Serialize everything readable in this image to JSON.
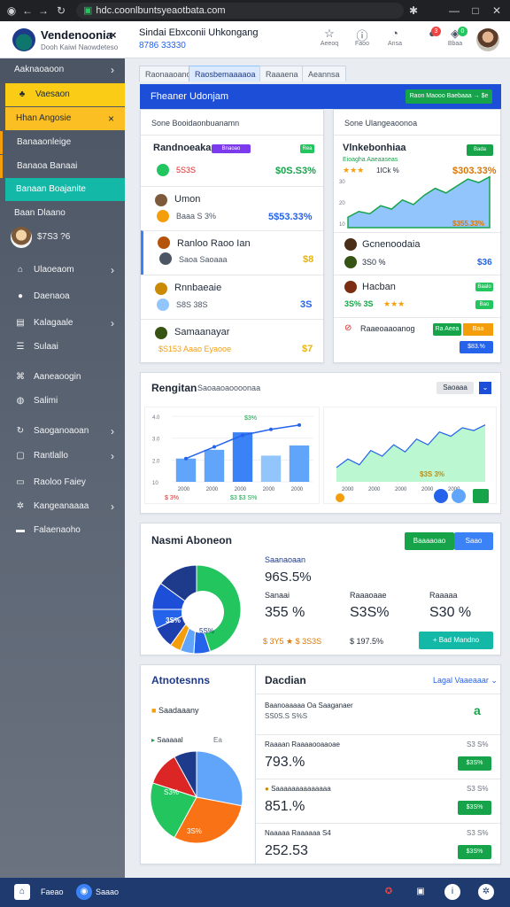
{
  "browser": {
    "url": "hdc.coonlbuntsyeaotbata.com"
  },
  "header": {
    "title": "Vendenoonia",
    "subtitle": "Dooh Kaiwi Naowdeteso",
    "close": "×",
    "mid_title": "Sindai Ebxconii Uhkongang",
    "mid_value": "8786 33330",
    "actions": [
      "Aeeoq",
      "Faoo",
      "Ansa",
      "Bbaa"
    ],
    "badges": [
      "3",
      "0"
    ]
  },
  "sidebar": {
    "items": [
      {
        "label": "Aaknaoaoon"
      },
      {
        "label": "Vaesaon"
      },
      {
        "label": "Hhan Angosie"
      },
      {
        "label": "Banaaonleige"
      },
      {
        "label": "Banaoa Banaai"
      },
      {
        "label": "Banaan Boajanite"
      },
      {
        "label": "Baan Dlaano"
      },
      {
        "label": "$7S3 ?6"
      },
      {
        "label": "Ulaoeaom"
      },
      {
        "label": "Daenaoa"
      },
      {
        "label": "Kalagaale"
      },
      {
        "label": "Sulaai"
      },
      {
        "label": "Aaneaoogin"
      },
      {
        "label": "Salimi"
      },
      {
        "label": "Saoganoaoan"
      },
      {
        "label": "Rantlallo"
      },
      {
        "label": "Raoloo Faiey"
      },
      {
        "label": "Kangeanaaaa"
      },
      {
        "label": "Falaenaoho"
      }
    ]
  },
  "tabs": [
    "Raonaaoano",
    "Raosbemaaaaoa",
    "Raaaena",
    "Aeannsa"
  ],
  "top_panel": {
    "bar_title": "Fheaner Udonjam",
    "bar_button": "Raon Maooo Baebaaa →  $e",
    "left_header": "Sone  Booidaonbuanamn",
    "right_header": "Sone  Ulangeaoonoa",
    "left_rows": [
      {
        "title": "Randnoeaka",
        "tag": "Bnaoao",
        "pill": "Rea",
        "sub": "5S3S",
        "value": "$0S.S3%"
      },
      {
        "title": "Umon",
        "sub": "Baaa S 3%",
        "value": "5$53.33%"
      },
      {
        "title": "Ranloo Raoo Ian",
        "sub": "Saoa Saoaaa",
        "value": "$8"
      },
      {
        "title": "Rnnbaeaie",
        "sub": "S8S 38S",
        "value": "3S"
      },
      {
        "title": "Samaanayar",
        "sub": "$S153  Aaao Eyaooe",
        "value": "$7"
      }
    ],
    "right_rows": [
      {
        "title": "Vlnkebonhiaa",
        "pill": "Bada",
        "sub": "Eioagha Aaeaaseas",
        "stars": "★★★",
        "stars_text": "1ICk %",
        "value": "$303.33%",
        "chart_label": "$355.33%"
      },
      {
        "title": "Gcnenoodaia",
        "sub": "3S0 %",
        "value": "$36"
      },
      {
        "title": "Hacban",
        "pill": "Baalo",
        "sub": "3S% 3S",
        "pill2": "Bao",
        "stars": "★★★"
      },
      {
        "title": "Raaeoaaoanog",
        "btn1": "Ra Aeea",
        "btn2": "Baa",
        "btn3": "$83.%"
      }
    ]
  },
  "mid_panel": {
    "title": "Rengitan",
    "subtitle": "Saoaaoaoooonaa",
    "search_btn": "Saoaaa",
    "bar_values": [
      {
        "label": "$S 3%"
      },
      {
        "label": "$3"
      },
      {
        "label": "$3 S%"
      }
    ],
    "legend_text": "$3%",
    "bottom_left": "$ 3%",
    "bottom_mid": "$3   $3 S%",
    "chart_label": "$3S 3%",
    "x_ticks": [
      "2000",
      "2000",
      "2000",
      "2000",
      "2000"
    ],
    "y_ticks": [
      "4.0",
      "3.0",
      "2.0",
      "10"
    ],
    "right_ticks": [
      "2000",
      "2000",
      "2000",
      "2000",
      "2000"
    ]
  },
  "chart_data": [
    {
      "type": "bar",
      "categories": [
        "2000",
        "2000",
        "2000",
        "2000",
        "2000"
      ],
      "values": [
        1.6,
        2.2,
        3.4,
        1.8,
        2.5
      ],
      "ylim": [
        0,
        4.5
      ]
    },
    {
      "type": "line",
      "x": [
        1,
        2,
        3,
        4,
        5
      ],
      "values": [
        1.6,
        2.4,
        3.2,
        3.6,
        3.9
      ],
      "ylim": [
        0,
        4.5
      ]
    },
    {
      "type": "area",
      "values": [
        0.9,
        1.4,
        1.2,
        1.9,
        1.6,
        2.4,
        2.0,
        2.8,
        3.4,
        3.0,
        3.6,
        4.2,
        3.9,
        4.4
      ]
    },
    {
      "type": "area",
      "values": [
        1,
        1.6,
        1.2,
        2.2,
        1.8,
        2.6,
        2.1,
        3.0,
        2.6,
        3.5,
        3.2,
        3.8,
        3.6,
        4.0
      ]
    },
    {
      "type": "pie",
      "values": [
        45,
        6,
        5,
        4,
        8,
        7,
        10,
        15
      ]
    },
    {
      "type": "pie",
      "values": [
        28,
        30,
        22,
        12,
        8
      ]
    }
  ],
  "nasmi": {
    "title": "Nasmi Aboneon",
    "btn_green": "Baaaaoao",
    "btn_blue": "Saao",
    "donut_label1": "3S%",
    "donut_label2": "5S%",
    "metric_head": "Saanaoaan",
    "metric_main": "96S.5%",
    "stats": [
      {
        "label": "Sanaai",
        "value": "355 %"
      },
      {
        "label": "Raaaoaae",
        "value": "S3S%"
      },
      {
        "label": "Raaaaa",
        "value": "S30 %"
      }
    ],
    "footer_left": "$ 3Y5 ★  $ 3S3S",
    "footer_mid": "$ 197.5%",
    "footer_btn": "+ Bad Mandno"
  },
  "bottom_panel": {
    "left_title": "Atnotesnns",
    "left_sub": "Saadaaany",
    "legend": "Saaaaal",
    "legend2": "Ea",
    "pie_labels": [
      "S3%",
      "3S%"
    ],
    "right_title": "Dacdian",
    "right_link": "Lagal Vaaeaaar ⌄",
    "summary_title": "Baanoaaaaa Oa Saaganaer",
    "summary_sub": "SS0S.S S%S",
    "summary_icon": "a",
    "rows": [
      {
        "label": "Raaaan Raaaaooaaoae",
        "right": "S3 S%",
        "value": "793.%",
        "pill": "$3S%"
      },
      {
        "label": "Saaaaaaaaaaaaaa",
        "right": "S3 S%",
        "value": "851.%",
        "pill": "$3S%"
      },
      {
        "label": "Naaaaa Raaaaaa S4",
        "right": "S3 S%",
        "value": "252.53",
        "pill": "$3S%"
      }
    ]
  },
  "bottombar": {
    "left1": "Faeao",
    "left2": "Saaao"
  },
  "colors": {
    "accent_blue": "#1d4ed8",
    "accent_green": "#16a34a",
    "sidebar": "#4b5563",
    "highlight_yellow": "#facc15",
    "highlight_teal": "#14b8a6"
  }
}
